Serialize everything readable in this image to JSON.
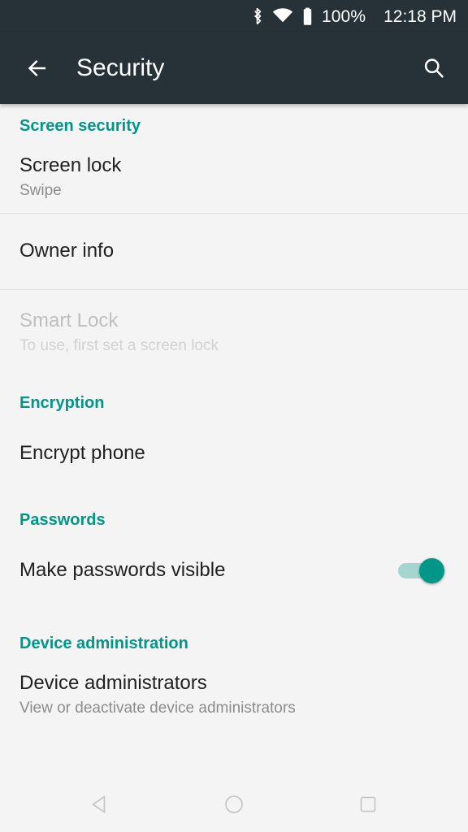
{
  "statusbar": {
    "bluetooth_icon": "bluetooth-icon",
    "wifi_icon": "wifi-icon",
    "battery_icon": "battery-full-icon",
    "battery_level": "100%",
    "time": "12:18 PM"
  },
  "appbar": {
    "back_icon": "arrow-back-icon",
    "title": "Security",
    "search_icon": "search-icon"
  },
  "sections": [
    {
      "header": "Screen security",
      "rows": [
        {
          "title": "Screen lock",
          "subtitle": "Swipe"
        },
        {
          "title": "Owner info",
          "subtitle": ""
        },
        {
          "title": "Smart Lock",
          "subtitle": "To use, first set a screen lock"
        }
      ]
    },
    {
      "header": "Encryption",
      "rows": [
        {
          "title": "Encrypt phone",
          "subtitle": ""
        }
      ]
    },
    {
      "header": "Passwords",
      "rows": [
        {
          "title": "Make passwords visible",
          "subtitle": "",
          "switch_state": "on"
        }
      ]
    },
    {
      "header": "Device administration",
      "rows": [
        {
          "title": "Device administrators",
          "subtitle": "View or deactivate device administrators"
        }
      ]
    }
  ],
  "navbar": {
    "back_label": "back-nav",
    "home_label": "home-nav",
    "recents_label": "recents-nav"
  },
  "colors": {
    "appbar_bg": "#263238",
    "accent_teal": "#009688",
    "switch_track": "#a2d6cf",
    "content_bg": "#f4f4f4",
    "title_text": "#212121",
    "subtitle_text": "#8c8c8c",
    "disabled_text": "#bfbfbf",
    "divider": "#e0e0e0"
  }
}
